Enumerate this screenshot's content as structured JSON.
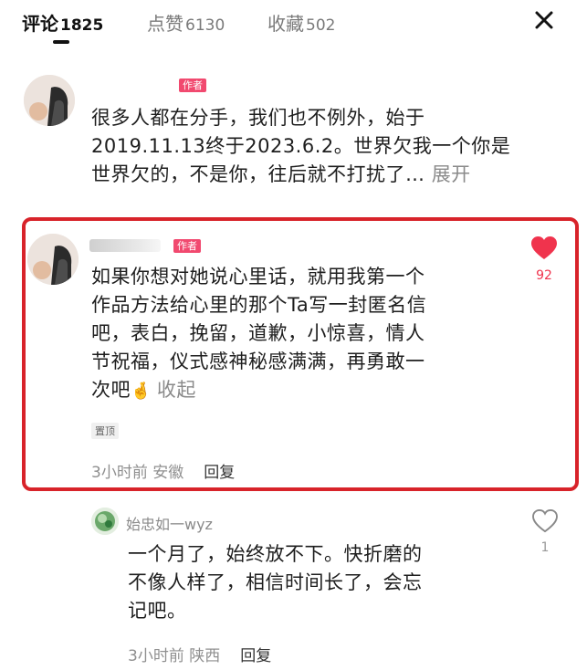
{
  "tabs": [
    {
      "label": "评论",
      "count": "1825"
    },
    {
      "label": "点赞",
      "count": "6130"
    },
    {
      "label": "收藏",
      "count": "502"
    }
  ],
  "author_badge": "作者",
  "comment1": {
    "lines": [
      "很多人都在分手，我们也不例外，始于",
      "2019.11.13终于2023.6.2。世界欠我一个你是",
      "世界欠的，不是你，往后就不打扰了…"
    ],
    "expand": "展开"
  },
  "comment2": {
    "lines": [
      "如果你想对她说心里话，就用我第一个",
      "作品方法给心里的那个Ta写一封匿名信",
      "吧，表白，挽留，道歉，小惊喜，情人",
      "节祝福，仪式感神秘感满满，再勇敢一",
      "次吧"
    ],
    "emoji": "🤞",
    "collapse": "收起",
    "pinned": "置顶",
    "likes": "92",
    "time": "3小时前",
    "location": "安徽",
    "reply": "回复",
    "like_color": "#f0334d"
  },
  "reply1": {
    "name": "始忠如一wyz",
    "lines": [
      "一个月了，始终放不下。快折磨的",
      "不像人样了，相信时间长了，会忘",
      "记吧。"
    ],
    "likes": "1",
    "time": "3小时前",
    "location": "陕西",
    "reply": "回复"
  },
  "colors": {
    "highlight_border": "#d8232a",
    "badge": "#f1496f"
  }
}
